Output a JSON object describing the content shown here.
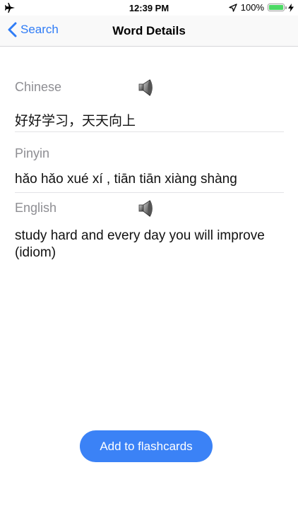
{
  "status_bar": {
    "time": "12:39 PM",
    "battery_percent": "100%",
    "battery_level": 1.0,
    "icons": [
      "airplane-icon",
      "location-arrow-icon",
      "battery-icon",
      "charging-bolt-icon"
    ]
  },
  "nav": {
    "back_label": "Search",
    "title": "Word Details"
  },
  "word": {
    "chinese_label": "Chinese",
    "chinese_value": "好好学习，天天向上",
    "pinyin_label": "Pinyin",
    "pinyin_value": "hǎo hǎo xué xí , tiān tiān xiàng shàng",
    "english_label": "English",
    "english_value": "study hard and every day you will improve (idiom)"
  },
  "actions": {
    "add_flashcards_label": "Add to flashcards"
  },
  "colors": {
    "accent": "#2f7cf6",
    "button": "#3b82f6",
    "label_gray": "#8e8e93",
    "battery_green": "#4cd964"
  }
}
